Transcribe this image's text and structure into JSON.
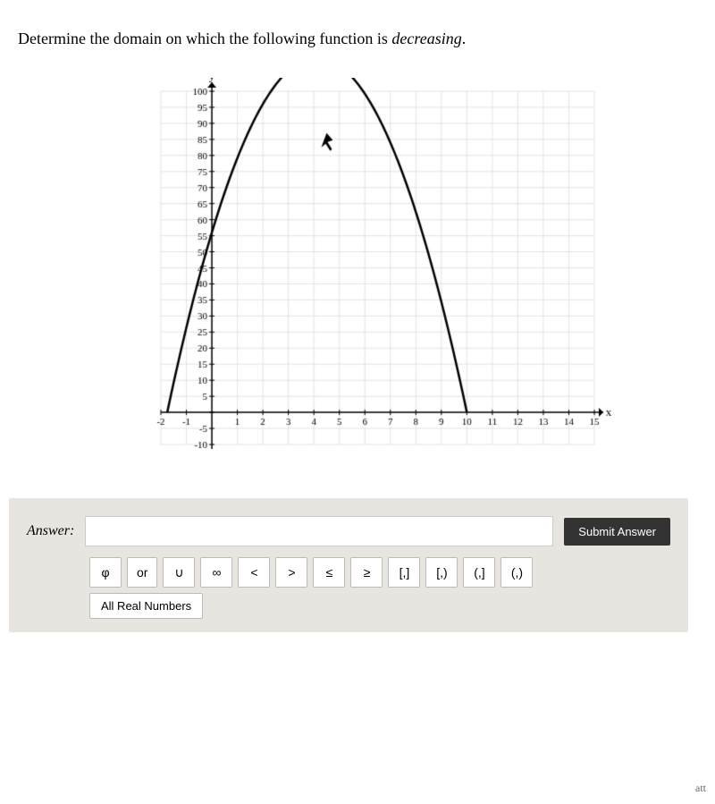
{
  "question": {
    "text_before": "Determine the domain on which the following function is ",
    "emphasis": "decreasing",
    "text_after": "."
  },
  "graph": {
    "y_label": "y",
    "x_label": "x",
    "y_axis": {
      "max": 100,
      "min": -10,
      "tick_interval": 5
    },
    "x_axis": {
      "min": -2,
      "max": 15
    }
  },
  "answer_section": {
    "label": "Answer:",
    "input_placeholder": "",
    "submit_label": "Submit Answer"
  },
  "symbols": [
    {
      "id": "phi",
      "label": "φ"
    },
    {
      "id": "or",
      "label": "or",
      "wide": true
    },
    {
      "id": "union",
      "label": "∪"
    },
    {
      "id": "infinity",
      "label": "∞"
    },
    {
      "id": "lt",
      "label": "<"
    },
    {
      "id": "gt",
      "label": ">"
    },
    {
      "id": "le",
      "label": "≤"
    },
    {
      "id": "ge",
      "label": "≥"
    },
    {
      "id": "bracket-open-close",
      "label": "[,]"
    },
    {
      "id": "bracket-open-paren",
      "label": "[,)"
    },
    {
      "id": "paren-open-close",
      "label": "(,]"
    },
    {
      "id": "paren-open-paren",
      "label": "(,)"
    }
  ],
  "all_real_numbers_label": "All Real Numbers",
  "att_text": "att"
}
